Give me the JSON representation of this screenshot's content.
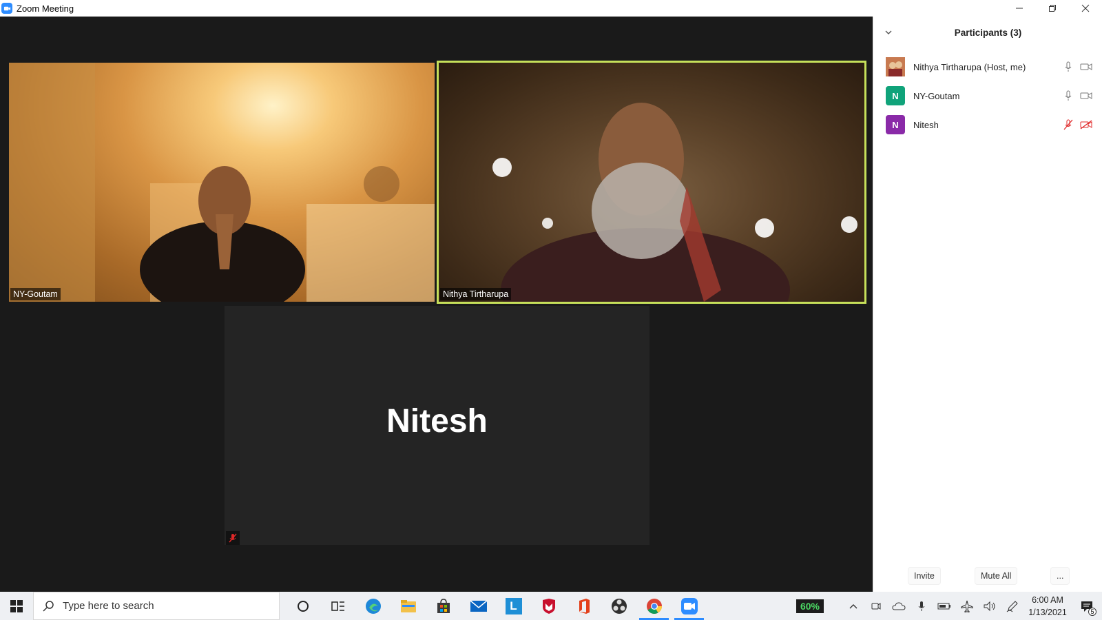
{
  "window": {
    "title": "Zoom Meeting",
    "icons": {
      "logo": "zoom-camera-icon",
      "minimize": "minimize-icon",
      "restore": "restore-icon",
      "close": "close-icon"
    }
  },
  "meeting": {
    "tiles": [
      {
        "name": "NY-Goutam"
      },
      {
        "name": "Nithya Tirtharupa",
        "active_speaker": true
      },
      {
        "name": "Nitesh",
        "display_name": "Nitesh",
        "muted": true
      }
    ]
  },
  "participants_panel": {
    "title": "Participants (3)",
    "participants": [
      {
        "name": "Nithya Tirtharupa (Host, me)",
        "avatar": "photo",
        "avatar_color": "#b56a45",
        "mic": "on",
        "video": "on"
      },
      {
        "name": "NY-Goutam",
        "avatar": "N",
        "avatar_color": "#10a37a",
        "mic": "on",
        "video": "on"
      },
      {
        "name": "Nitesh",
        "avatar": "N",
        "avatar_color": "#8a2aa8",
        "mic": "muted",
        "video": "off"
      }
    ],
    "buttons": {
      "invite": "Invite",
      "mute_all": "Mute All",
      "more": "..."
    }
  },
  "taskbar": {
    "search_placeholder": "Type here to search",
    "apps": [
      "cortana",
      "task-view",
      "edge",
      "file-explorer",
      "store",
      "mail",
      "app-l",
      "mcafee",
      "office",
      "obs",
      "chrome",
      "zoom"
    ],
    "app_l_letter": "L",
    "battery_percent": "60%",
    "time": "6:00 AM",
    "date": "1/13/2021",
    "notification_count": "5"
  },
  "colors": {
    "accent": "#2d8cff",
    "speaker_border": "#c6e05a",
    "muted_red": "#e02828"
  }
}
